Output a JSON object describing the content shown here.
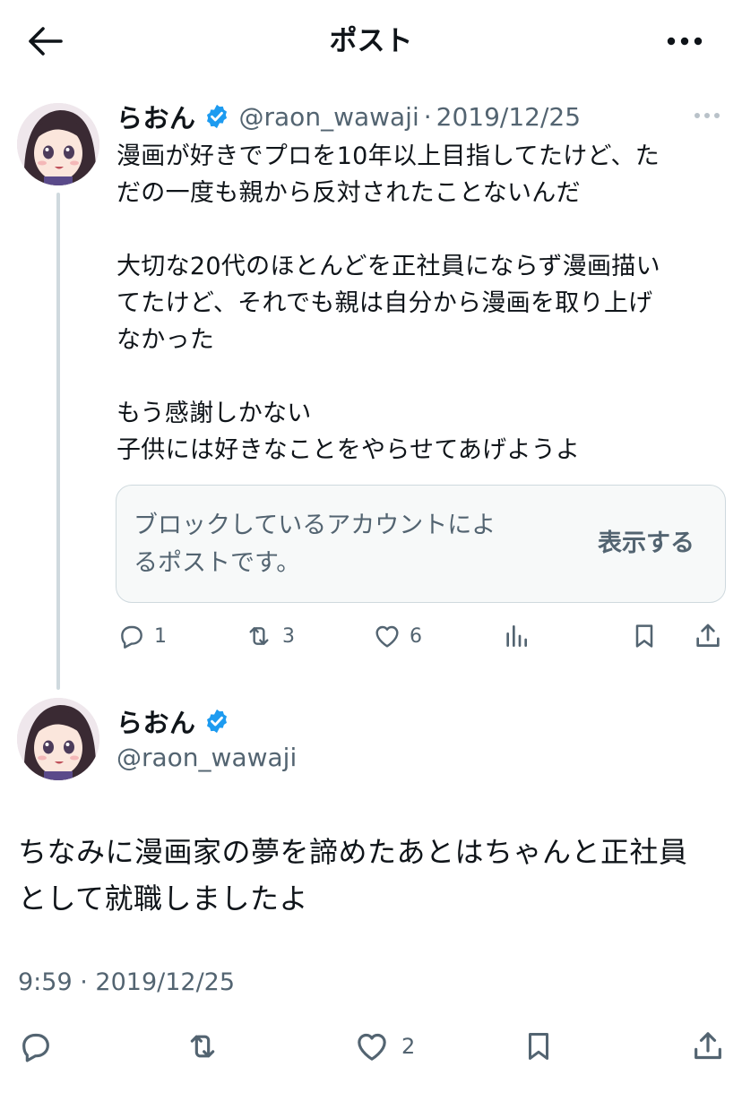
{
  "header": {
    "title": "ポスト",
    "back_icon": "arrow-left-icon",
    "more_icon": "more-horizontal-icon"
  },
  "parent_post": {
    "author_name": "らおん",
    "handle": "@raon_wawaji",
    "separator": "·",
    "date": "2019/12/25",
    "text": "漫画が好きでプロを10年以上目指してたけど、た\nだの一度も親から反対されたことないんだ\n\n大切な20代のほとんどを正社員にならず漫画描い\nてたけど、それでも親は自分から漫画を取り上げ\nなかった\n\nもう感謝しかない\n子供には好きなことをやらせてあげようよ",
    "blocked_quote": {
      "text": "ブロックしているアカウントによ\nるポストです。",
      "show_label": "表示する"
    },
    "actions": {
      "reply_count": "1",
      "repost_count": "3",
      "like_count": "6"
    }
  },
  "main_post": {
    "author_name": "らおん",
    "handle": "@raon_wawaji",
    "text": "ちなみに漫画家の夢を諦めたあとはちゃんと正社員\nとして就職しましたよ",
    "time": "9:59",
    "separator": "·",
    "date": "2019/12/25",
    "actions": {
      "like_count": "2"
    }
  },
  "colors": {
    "text": "#0f1419",
    "secondary": "#536471",
    "verified": "#1d9bf0",
    "border": "#cfd9de",
    "card_bg": "#f7f9f9"
  }
}
